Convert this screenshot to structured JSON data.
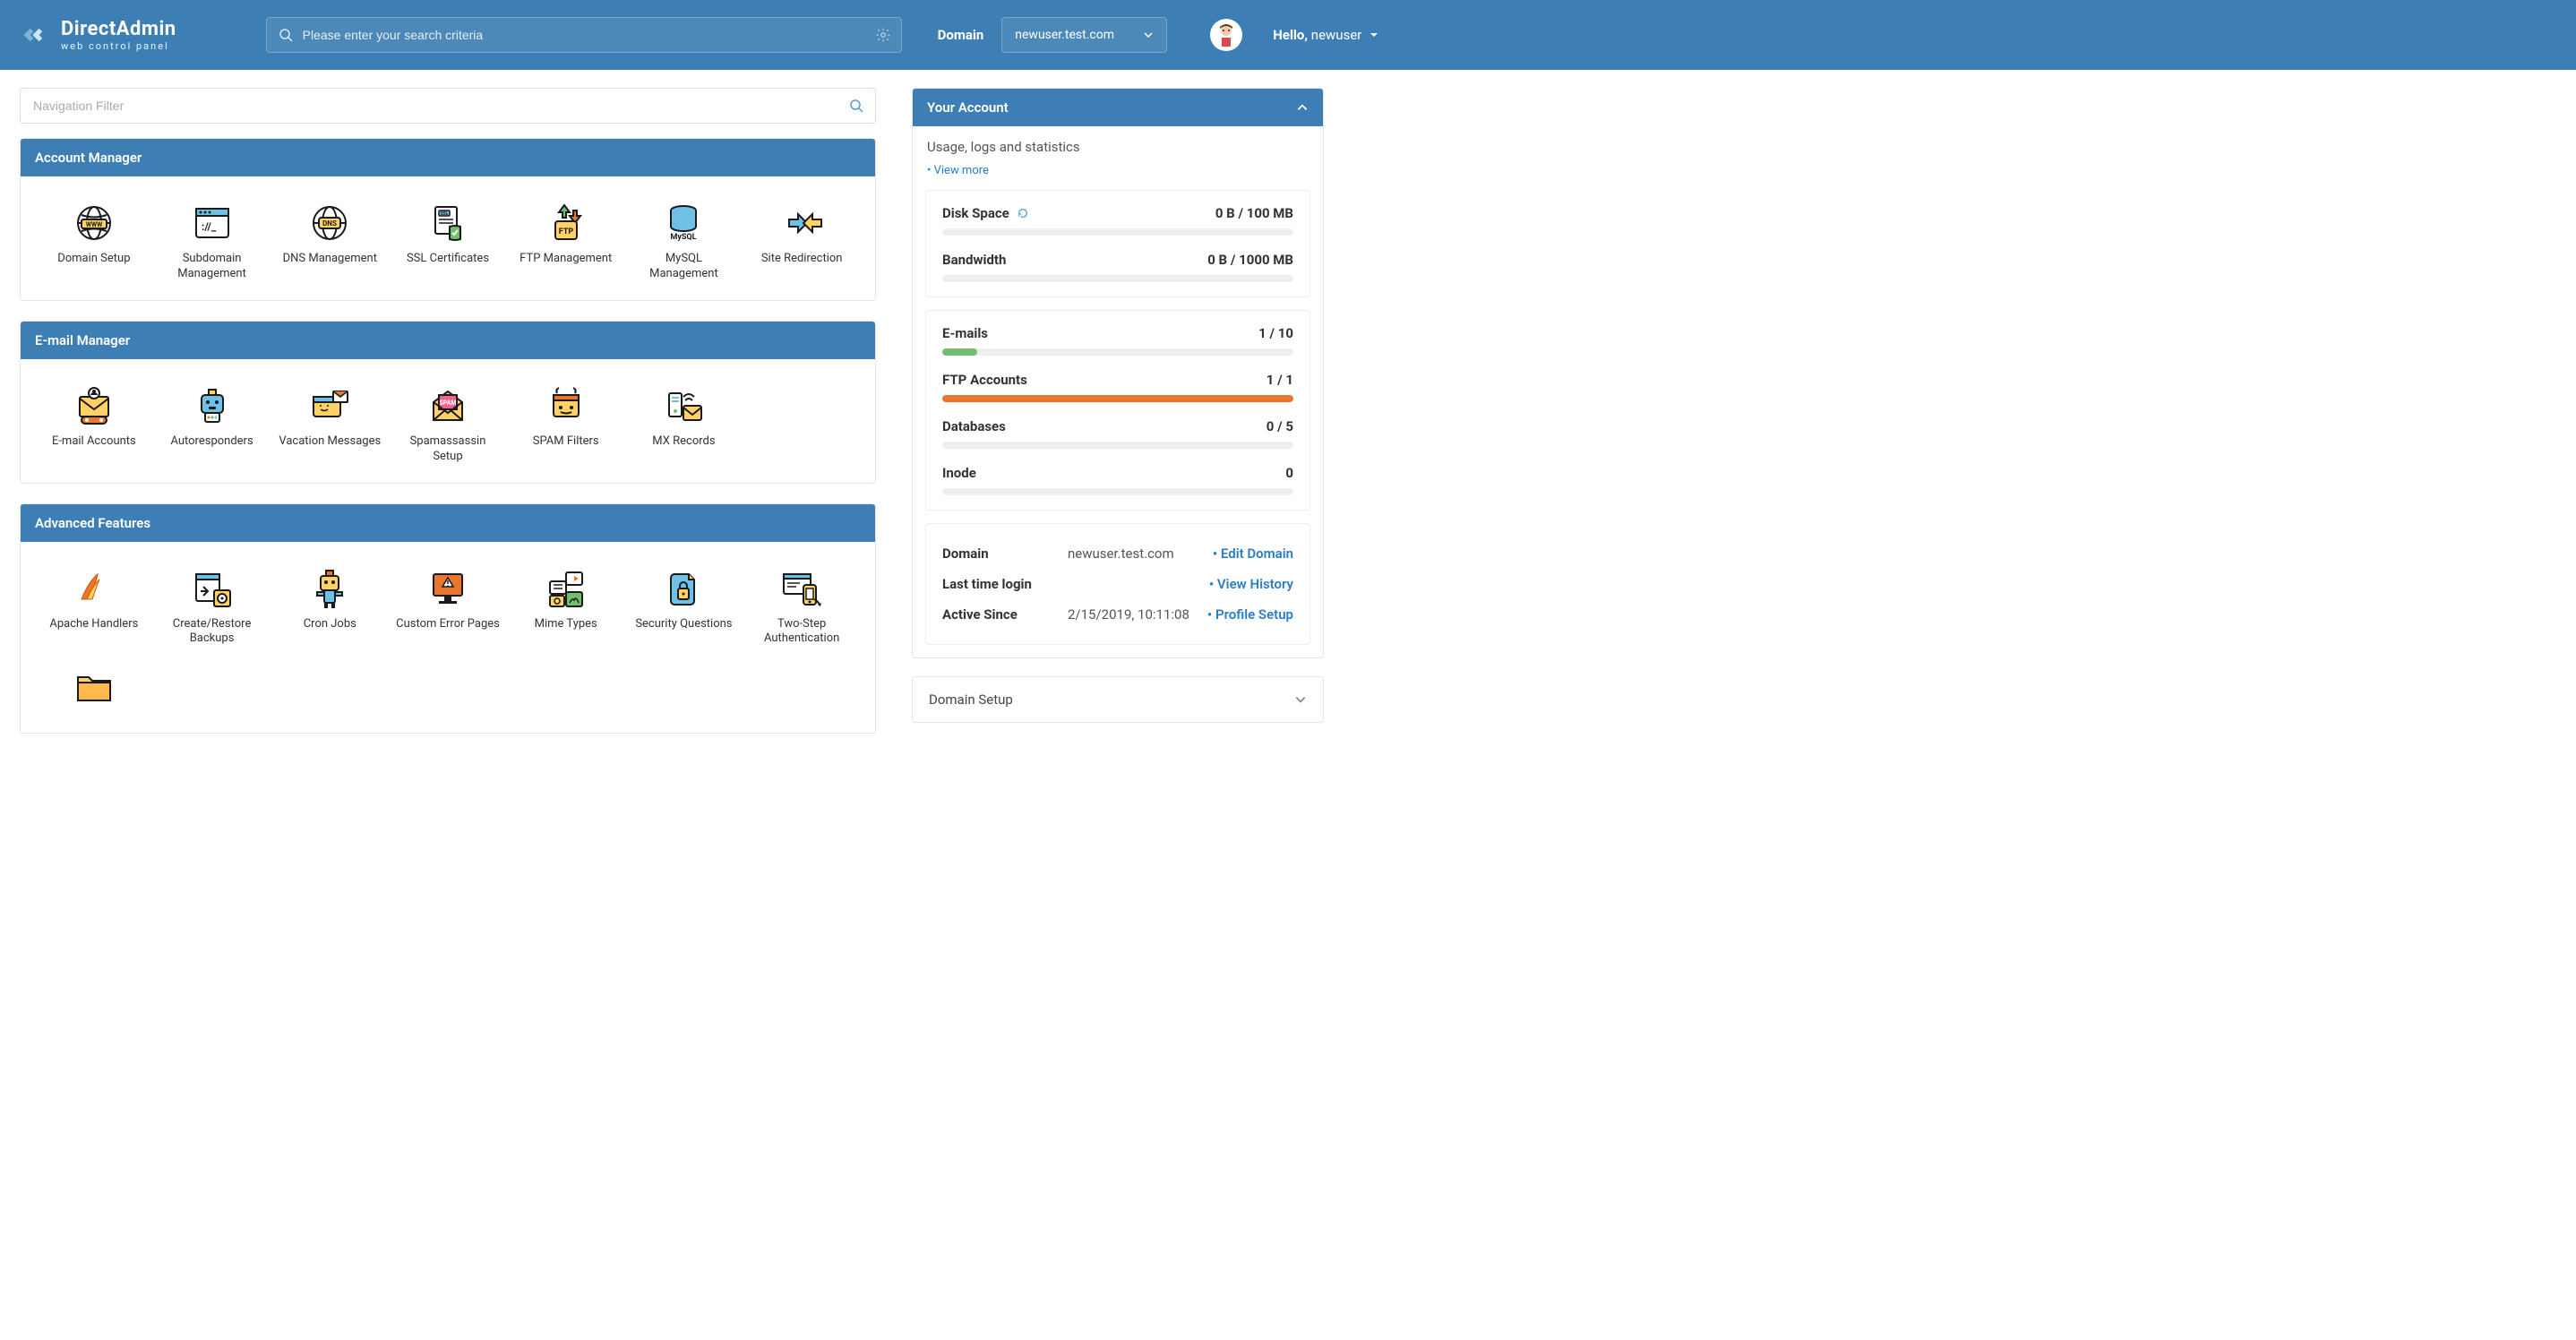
{
  "brand": {
    "title": "DirectAdmin",
    "subtitle": "web control panel"
  },
  "header": {
    "search_placeholder": "Please enter your search criteria",
    "domain_label": "Domain",
    "domain_selected": "newuser.test.com",
    "greeting_prefix": "Hello,",
    "username": "newuser"
  },
  "nav_filter": {
    "placeholder": "Navigation Filter"
  },
  "sections": [
    {
      "title": "Account Manager",
      "tiles": [
        {
          "name": "domain-setup",
          "label": "Domain Setup"
        },
        {
          "name": "subdomain-management",
          "label": "Subdomain Management"
        },
        {
          "name": "dns-management",
          "label": "DNS Management"
        },
        {
          "name": "ssl-certificates",
          "label": "SSL Certificates"
        },
        {
          "name": "ftp-management",
          "label": "FTP Management"
        },
        {
          "name": "mysql-management",
          "label": "MySQL Management"
        },
        {
          "name": "site-redirection",
          "label": "Site Redirection"
        }
      ]
    },
    {
      "title": "E-mail Manager",
      "tiles": [
        {
          "name": "email-accounts",
          "label": "E-mail Accounts"
        },
        {
          "name": "autoresponders",
          "label": "Autoresponders"
        },
        {
          "name": "vacation-messages",
          "label": "Vacation Messages"
        },
        {
          "name": "spamassassin-setup",
          "label": "Spamassassin Setup"
        },
        {
          "name": "spam-filters",
          "label": "SPAM Filters"
        },
        {
          "name": "mx-records",
          "label": "MX Records"
        }
      ]
    },
    {
      "title": "Advanced Features",
      "tiles": [
        {
          "name": "apache-handlers",
          "label": "Apache Handlers"
        },
        {
          "name": "create-restore-backups",
          "label": "Create/Restore Backups"
        },
        {
          "name": "cron-jobs",
          "label": "Cron Jobs"
        },
        {
          "name": "custom-error-pages",
          "label": "Custom Error Pages"
        },
        {
          "name": "mime-types",
          "label": "Mime Types"
        },
        {
          "name": "security-questions",
          "label": "Security Questions"
        },
        {
          "name": "two-step-auth",
          "label": "Two-Step Authentication"
        }
      ]
    }
  ],
  "account_panel": {
    "title": "Your Account",
    "subtitle": "Usage, logs and statistics",
    "view_more": "• View more",
    "stats_usage": [
      {
        "name": "Disk Space",
        "value": "0 B / 100 MB",
        "pct": 0,
        "color": "#ddd",
        "refresh": true
      },
      {
        "name": "Bandwidth",
        "value": "0 B / 1000 MB",
        "pct": 0,
        "color": "#ddd"
      }
    ],
    "stats_counts": [
      {
        "name": "E-mails",
        "value": "1 / 10",
        "pct": 10,
        "color": "#6fbf6f"
      },
      {
        "name": "FTP Accounts",
        "value": "1 / 1",
        "pct": 100,
        "color": "#e8762c"
      },
      {
        "name": "Databases",
        "value": "0 / 5",
        "pct": 0,
        "color": "#ddd"
      },
      {
        "name": "Inode",
        "value": "0",
        "pct": 0,
        "color": "#ddd"
      }
    ],
    "info": [
      {
        "key": "Domain",
        "val": "newuser.test.com",
        "action": "• Edit Domain"
      },
      {
        "key": "Last time login",
        "val": "",
        "action": "• View History"
      },
      {
        "key": "Active Since",
        "val": "2/15/2019, 10:11:08",
        "action": "• Profile Setup"
      }
    ]
  },
  "domain_setup_collapse": "Domain Setup"
}
